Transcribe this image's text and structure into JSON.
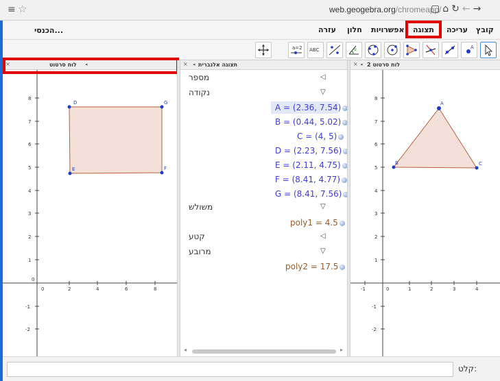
{
  "browser": {
    "url_host": "web.geogebra.org",
    "url_path": "/chromeapp/",
    "menu_icon": "hamburger-icon",
    "bookmark_icon": "star-icon",
    "nav_icons": [
      "page-icon",
      "home-icon",
      "reload-icon",
      "back-icon",
      "forward-icon"
    ]
  },
  "menu": {
    "signin": "הכנסי...",
    "items": [
      "קובץ",
      "עריכה",
      "תצוגה",
      "אפשרויות",
      "חלון",
      "עזרה"
    ],
    "highlighted": "תצוגה"
  },
  "toolbar": {
    "tools": [
      "move-tool",
      "point-tool",
      "line-tool",
      "perpendicular-tool",
      "polygon-tool",
      "circle-tool",
      "circle-three-points-tool",
      "angle-tool",
      "reflect-tool",
      "text-tool",
      "slider-tool",
      "move-graphics-tool"
    ],
    "slider_label": "a=2",
    "text_label": "ABC"
  },
  "views": {
    "graphics1": {
      "title": "לוח סרטוט"
    },
    "algebra": {
      "title": "תצוגה אלגברית"
    },
    "graphics2": {
      "title": "לוח סרטוט 2"
    }
  },
  "algebra": {
    "categories": [
      {
        "name": "מספר",
        "expanded": false
      },
      {
        "name": "נקודה",
        "expanded": true
      },
      {
        "name": "משולש",
        "expanded": true
      },
      {
        "name": "קטע",
        "expanded": false
      },
      {
        "name": "מרובע",
        "expanded": true
      }
    ],
    "points": [
      "A = (2.36, 7.54)",
      "B = (0.44, 5.02)",
      "C = (4, 5)",
      "D = (2.23, 7.56)",
      "E = (2.11, 4.75)",
      "F = (8.41, 4.77)",
      "G = (8.41, 7.56)"
    ],
    "triangle": "poly1 = 4.5",
    "quad": "poly2 = 17.5"
  },
  "graphics1": {
    "x_ticks": [
      "0",
      "2",
      "4",
      "6",
      "8"
    ],
    "y_ticks": [
      "8",
      "7",
      "6",
      "5",
      "4",
      "3",
      "2",
      "1",
      "0",
      "-1",
      "-2"
    ],
    "labels": [
      "D",
      "G",
      "E",
      "F"
    ]
  },
  "graphics2": {
    "x_ticks": [
      "-1",
      "0",
      "1",
      "2",
      "3",
      "4"
    ],
    "y_ticks": [
      "8",
      "7",
      "6",
      "5",
      "4",
      "3",
      "2",
      "1",
      "-1",
      "-2"
    ],
    "labels": [
      "A",
      "B",
      "C"
    ]
  },
  "input": {
    "label": "קלט:",
    "value": ""
  },
  "colors": {
    "highlight_red": "#e00000",
    "point_blue": "#1f3bcc",
    "poly_fill": "#f3ddd4",
    "poly_stroke": "#b8603a",
    "algebra_point_text": "#3d3dd8",
    "algebra_poly_text": "#9a5a2a"
  }
}
